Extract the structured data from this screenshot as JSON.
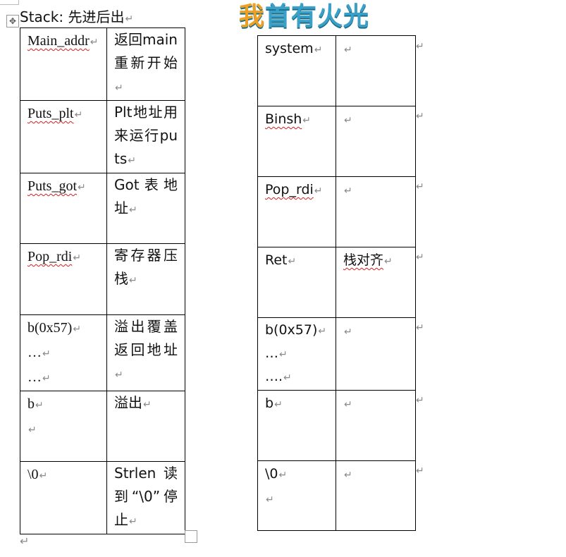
{
  "heading": "Stack:  先进后出",
  "logo": {
    "part1": "我",
    "part2": "首有火光"
  },
  "paragraph_mark": "↵",
  "left_table": {
    "rows": [
      {
        "key": "Main_addr",
        "value": "返回main重新开始"
      },
      {
        "key": "Puts_plt",
        "value": "Plt地址用来运行puts"
      },
      {
        "key": "Puts_got",
        "value": "Got表地址"
      },
      {
        "key": "Pop_rdi",
        "value": "寄存器压栈"
      },
      {
        "key_lines": [
          "b(0x57)",
          "…",
          "…"
        ],
        "value": "溢出覆盖返回地址"
      },
      {
        "key_lines": [
          "b",
          ""
        ],
        "value": "溢出"
      },
      {
        "key": "\\0",
        "value": "Strlen读到“\\0”停止"
      }
    ]
  },
  "right_table": {
    "rows": [
      {
        "key": "system",
        "value": ""
      },
      {
        "key": "Binsh",
        "value": ""
      },
      {
        "key": "Pop_rdi",
        "value": ""
      },
      {
        "key": "Ret",
        "value": "栈对齐"
      },
      {
        "key_lines": [
          "b(0x57)",
          "…",
          "….",
          ""
        ],
        "value": ""
      },
      {
        "key": "b",
        "value": ""
      },
      {
        "key_lines": [
          "\\0",
          ""
        ],
        "value": ""
      }
    ]
  }
}
